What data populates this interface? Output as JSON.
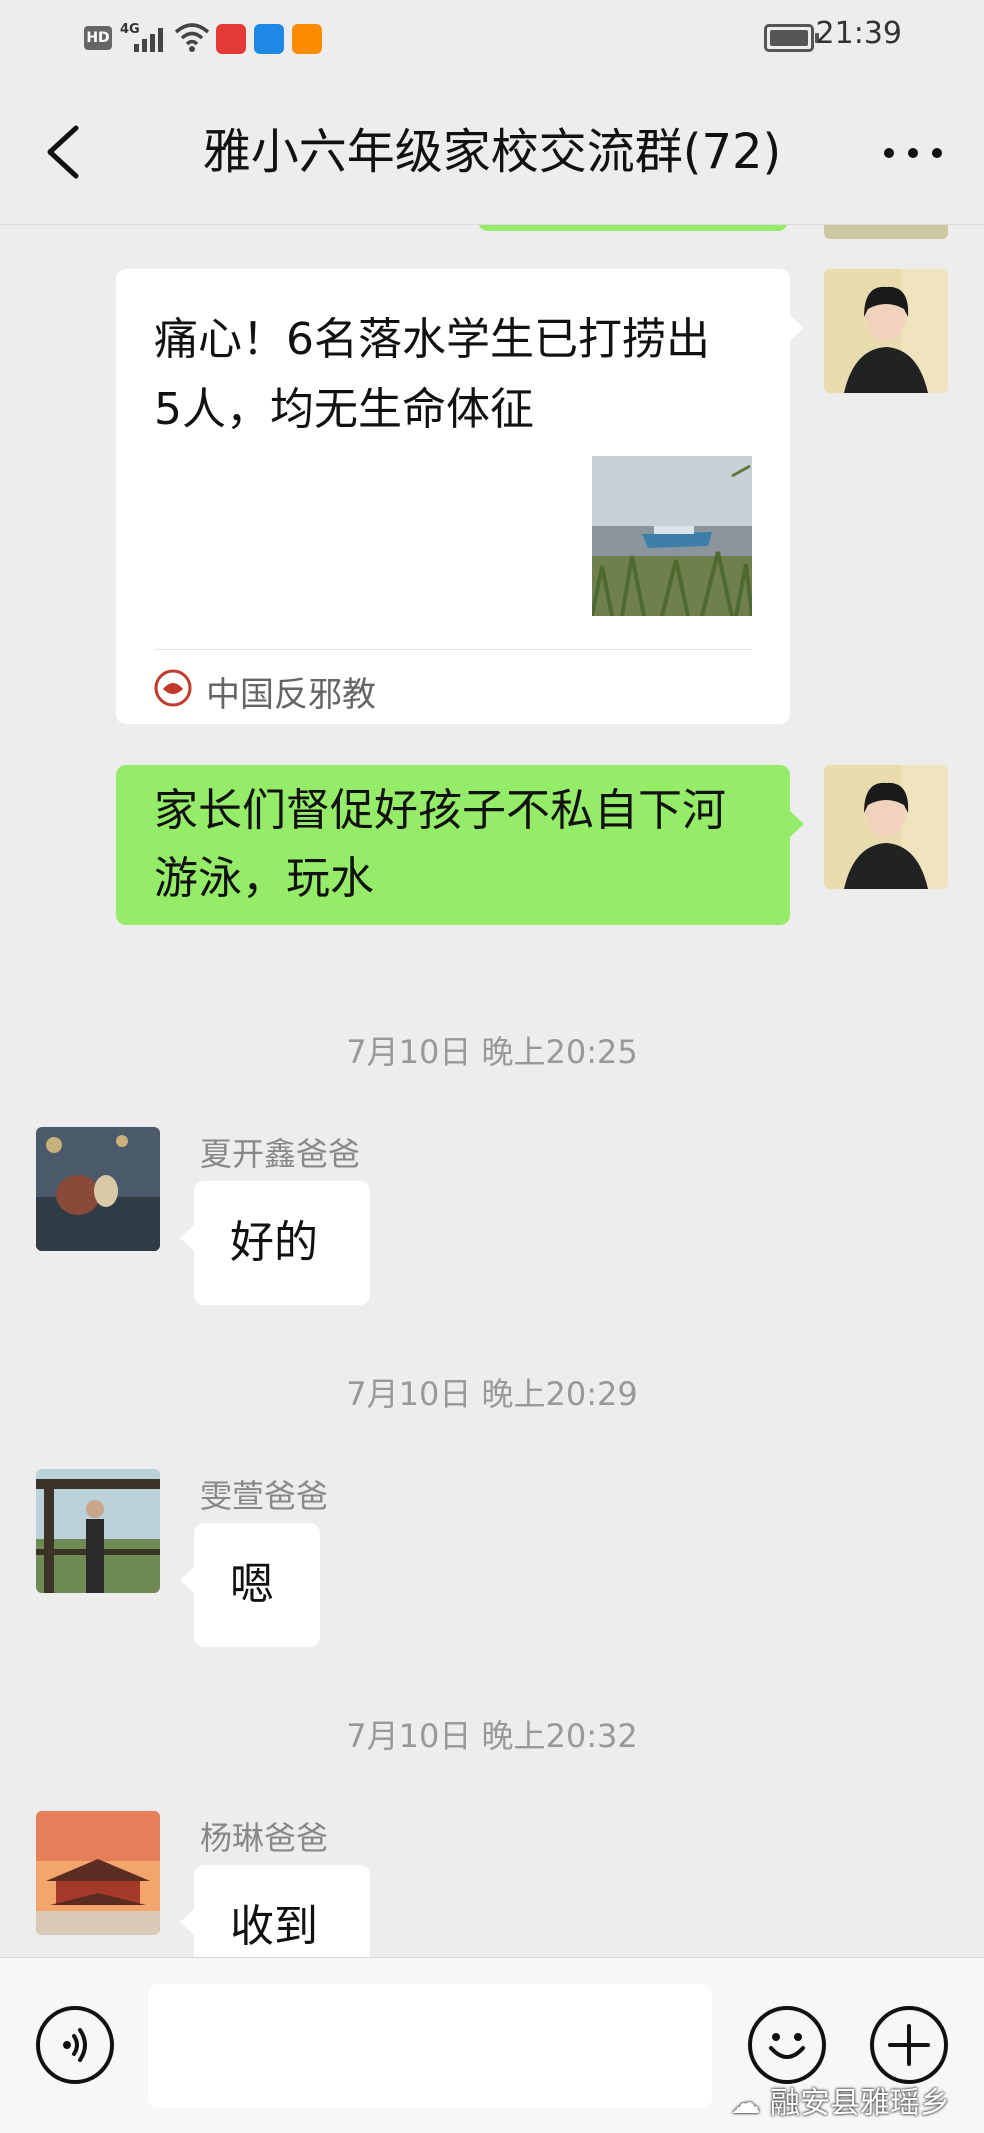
{
  "status_bar": {
    "hd": "HD",
    "network": "4G",
    "time": "21:39"
  },
  "nav": {
    "title": "雅小六年级家校交流群(72)",
    "back_icon": "chevron-left-icon",
    "more_icon": "more-dots-icon"
  },
  "messages": {
    "article": {
      "title": "痛心！6名落水学生已打捞出5人，均无生命体征",
      "source": "中国反邪教"
    },
    "self_text": "家长们督促好孩子不私自下河游泳，玩水",
    "groups": [
      {
        "time": "7月10日 晚上20:25",
        "sender": "夏开鑫爸爸",
        "text": "好的"
      },
      {
        "time": "7月10日 晚上20:29",
        "sender": "雯萱爸爸",
        "text": "嗯"
      },
      {
        "time": "7月10日 晚上20:32",
        "sender": "杨琳爸爸",
        "text": "收到"
      }
    ]
  },
  "input_bar": {
    "voice_icon": "voice-icon",
    "emoji_icon": "emoji-icon",
    "plus_icon": "plus-icon",
    "watermark": "融安县雅瑶乡"
  },
  "colors": {
    "background": "#ededed",
    "self_bubble": "#95ec69",
    "other_bubble": "#ffffff"
  }
}
